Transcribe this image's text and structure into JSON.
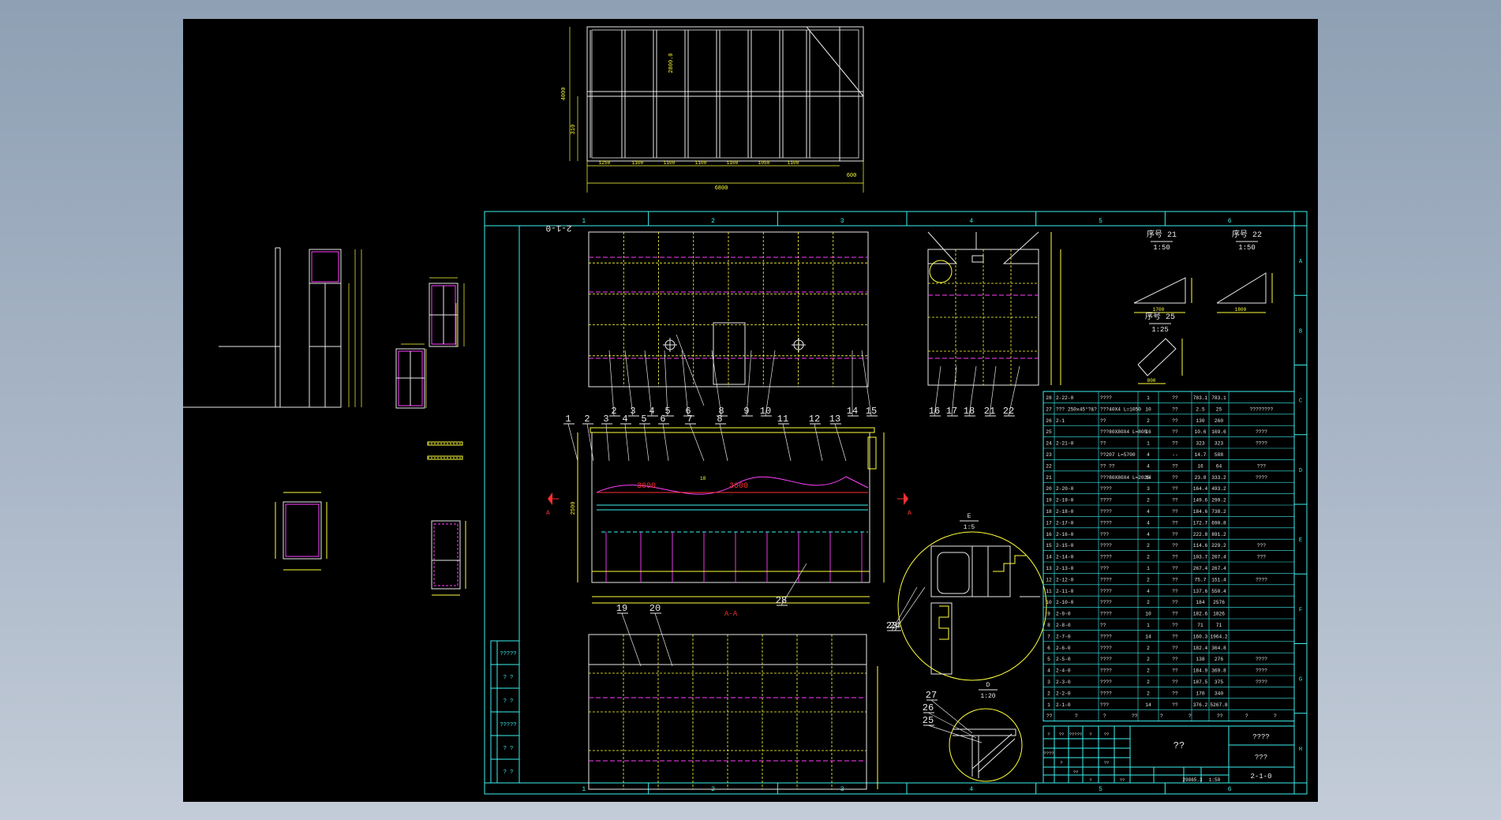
{
  "colors": {
    "background": "#000000",
    "frame": "#3cf0f0",
    "outline": "#e8e8e8",
    "dimension": "#ffff3c",
    "hidden": "#ff40ff",
    "accent": "#ff3030"
  },
  "top_view": {
    "dims_bottom": [
      "1250",
      "1100",
      "1100",
      "1100",
      "1100",
      "1050",
      "1100"
    ],
    "overall_width": "6800",
    "end_dim": "600",
    "dims_left": [
      "4000",
      "310"
    ],
    "inner_height": "2800.0"
  },
  "frame": {
    "columns": [
      "1",
      "2",
      "3",
      "4",
      "5",
      "6"
    ],
    "rows": [
      "A",
      "B",
      "C",
      "D",
      "E",
      "F",
      "G",
      "H"
    ]
  },
  "views": {
    "top_right_title": "2-1-0",
    "callouts_top": [
      "2",
      "3",
      "4",
      "5",
      "6",
      "8",
      "9",
      "10",
      "14",
      "15"
    ],
    "callouts_top_right": [
      "16",
      "17",
      "18",
      "21",
      "22"
    ],
    "callouts_section": [
      "1",
      "2",
      "3",
      "4",
      "5",
      "6",
      "7",
      "8",
      "11",
      "12",
      "13"
    ],
    "callouts_bottom": [
      "19",
      "20"
    ],
    "callout_28": "28",
    "section_label": "A-A",
    "section_marker": "A",
    "span_label_1": "3600",
    "span_label_2": "3600",
    "rotated_label": "2-1-0",
    "dim_middle": "18",
    "dim_section_height": "2500"
  },
  "details": {
    "d21_title": "序号 21",
    "d21_scale": "1:50",
    "d22_title": "序号 22",
    "d22_scale": "1:50",
    "d25_title": "序号 25",
    "d25_scale": "1:25",
    "e_title": "E",
    "e_scale": "1:5",
    "d_title": "D",
    "d_scale": "1:20",
    "callouts_e": [
      "23",
      "24"
    ],
    "callouts_d": [
      "27",
      "26",
      "25"
    ],
    "dim_21a": "1700",
    "dim_22a": "1800",
    "dim_25a": "800"
  },
  "bom": [
    [
      "28",
      "2-22-0",
      "????",
      "1",
      "??",
      "783.1",
      "783.1",
      ""
    ],
    [
      "27",
      "??? 250x45°?&?",
      "???40X4 L=1050",
      "10",
      "??",
      "2.5",
      "25",
      "????????"
    ],
    [
      "26",
      "2-1",
      "??",
      "2",
      "??",
      "130",
      "260",
      ""
    ],
    [
      "25",
      "",
      "???80X80X4 L=805",
      "16",
      "??",
      "10.6",
      "169.6",
      "????"
    ],
    [
      "24",
      "2-21-0",
      "??",
      "1",
      "??",
      "323",
      "323",
      "????"
    ],
    [
      "23",
      "",
      "??207 L=5700",
      "4",
      "--",
      "14.7",
      "588",
      ""
    ],
    [
      "22",
      "",
      "?? ??",
      "4",
      "??",
      "16",
      "64",
      "???"
    ],
    [
      "21",
      "",
      "???80X80X4 L=2025",
      "14",
      "??",
      "23.8",
      "333.2",
      "????"
    ],
    [
      "20",
      "2-20-0",
      "????",
      "3",
      "??",
      "164.4",
      "493.2",
      ""
    ],
    [
      "19",
      "2-19-0",
      "????",
      "2",
      "??",
      "149.6",
      "299.2",
      ""
    ],
    [
      "18",
      "2-18-0",
      "????",
      "4",
      "??",
      "184.6",
      "738.2",
      ""
    ],
    [
      "17",
      "2-17-0",
      "????",
      "4",
      "??",
      "172.7",
      "690.8",
      ""
    ],
    [
      "16",
      "2-16-0",
      "???",
      "4",
      "??",
      "222.8",
      "891.2",
      ""
    ],
    [
      "15",
      "2-15-0",
      "????",
      "2",
      "??",
      "114.6",
      "229.2",
      "???"
    ],
    [
      "14",
      "2-14-0",
      "????",
      "2",
      "??",
      "103.7",
      "207.4",
      "???"
    ],
    [
      "13",
      "2-13-0",
      "???",
      "1",
      "??",
      "267.4",
      "267.4",
      ""
    ],
    [
      "12",
      "2-12-0",
      "????",
      "2",
      "??",
      "75.7",
      "151.4",
      "????"
    ],
    [
      "11",
      "2-11-0",
      "????",
      "4",
      "??",
      "137.6",
      "550.4",
      ""
    ],
    [
      "10",
      "2-10-0",
      "????",
      "2",
      "??",
      "184",
      "2576",
      ""
    ],
    [
      "9",
      "2-9-0",
      "????",
      "10",
      "??",
      "182.6",
      "1826",
      ""
    ],
    [
      "8",
      "2-8-0",
      "??",
      "1",
      "??",
      "71",
      "71",
      ""
    ],
    [
      "7",
      "2-7-0",
      "????",
      "14",
      "??",
      "160.3",
      "1964.2",
      ""
    ],
    [
      "6",
      "2-6-0",
      "????",
      "2",
      "??",
      "182.4",
      "364.8",
      ""
    ],
    [
      "5",
      "2-5-0",
      "????",
      "2",
      "??",
      "138",
      "276",
      "????"
    ],
    [
      "4",
      "2-4-0",
      "????",
      "2",
      "??",
      "184.9",
      "369.8",
      "????"
    ],
    [
      "3",
      "2-3-0",
      "????",
      "2",
      "??",
      "187.5",
      "375",
      "????"
    ],
    [
      "2",
      "2-2-0",
      "????",
      "2",
      "??",
      "170",
      "340",
      ""
    ],
    [
      "1",
      "2-1-0",
      "???",
      "14",
      "??",
      "376.2",
      "5267.8",
      ""
    ]
  ],
  "bom_header": [
    "??",
    "?",
    "?",
    "??",
    "?",
    "?",
    "??",
    "?",
    "?"
  ],
  "title_block": {
    "name": "??",
    "company": "????",
    "project": "???",
    "drawing_no": "2-1-0",
    "weight": "29865.3",
    "scale": "1:50",
    "small_labels": [
      "?",
      "??",
      "?????",
      "?",
      "??",
      "????",
      "?",
      "??",
      "?",
      "??",
      "??"
    ],
    "left_strip": [
      "?????",
      "? ?",
      "? ?",
      "?????",
      "? ?",
      "? ?"
    ]
  }
}
